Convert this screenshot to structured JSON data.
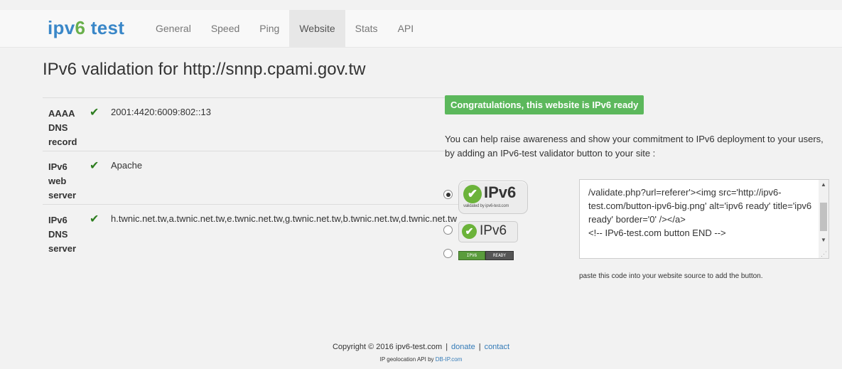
{
  "brand": {
    "prefix": "ipv",
    "six": "6",
    "suffix": " test"
  },
  "nav": [
    {
      "label": "General"
    },
    {
      "label": "Speed"
    },
    {
      "label": "Ping"
    },
    {
      "label": "Website",
      "active": true
    },
    {
      "label": "Stats"
    },
    {
      "label": "API"
    }
  ],
  "page_title": "IPv6 validation for http://snnp.cpami.gov.tw",
  "records": [
    {
      "label": "AAAA DNS record",
      "status": "✔",
      "value": "2001:4420:6009:802::13"
    },
    {
      "label": "IPv6 web server",
      "status": "✔",
      "value": "Apache"
    },
    {
      "label": "IPv6 DNS server",
      "status": "✔",
      "value": "h.twnic.net.tw,a.twnic.net.tw,e.twnic.net.tw,g.twnic.net.tw,b.twnic.net.tw,d.twnic.net.tw"
    }
  ],
  "congrats": "Congratulations, this website is IPv6 ready",
  "awareness": "You can help raise awareness and show your commitment to IPv6 deployment to your users, by adding an IPv6-test validator button to your site :",
  "badges": {
    "big": {
      "tick": "✔",
      "text": "IPv6",
      "sub": "validated by ipv6-test.com"
    },
    "mid": {
      "tick": "✔",
      "text": "IPv6"
    },
    "small": {
      "left": "IPV6",
      "right": "READY"
    },
    "selected": "big"
  },
  "code_snippet": "/validate.php?url=referer'><img src='http://ipv6-test.com/button-ipv6-big.png' alt='ipv6 ready' title='ipv6 ready' border='0' /></a>\n<!-- IPv6-test.com button END -->",
  "paste_note": "paste this code into your website source to add the button.",
  "footer": {
    "copyright": "Copyright © 2016 ipv6-test.com",
    "separator": "|",
    "donate": "donate",
    "contact": "contact",
    "geo_prefix": "IP geolocation API by ",
    "geo_link": "DB-IP.com"
  },
  "colors": {
    "accent": "#3a87c8",
    "success": "#5cb85c",
    "check": "#2d7d1f"
  }
}
